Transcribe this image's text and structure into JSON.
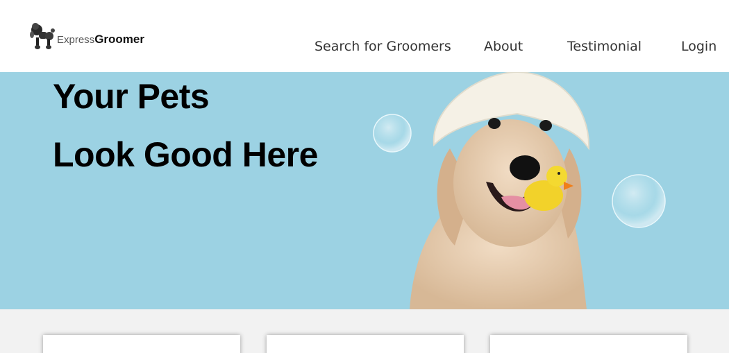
{
  "brand": {
    "logo_thin": "Express",
    "logo_bold": "Groomer"
  },
  "nav": {
    "items": [
      "Search for Groomers",
      "About",
      "Testimonial",
      "Login"
    ]
  },
  "hero": {
    "title_line1": "Your Pets",
    "title_line2": "Look Good Here",
    "image_subject": "golden-retriever-shower-cap-rubber-duck",
    "background_color": "#9cd2e3"
  },
  "cards": [
    {
      "name": "feature-card-1"
    },
    {
      "name": "feature-card-2"
    },
    {
      "name": "feature-card-3"
    }
  ],
  "colors": {
    "hero_bg": "#9cd2e3",
    "section_bg": "#f2f2f2",
    "nav_text": "#333333"
  }
}
